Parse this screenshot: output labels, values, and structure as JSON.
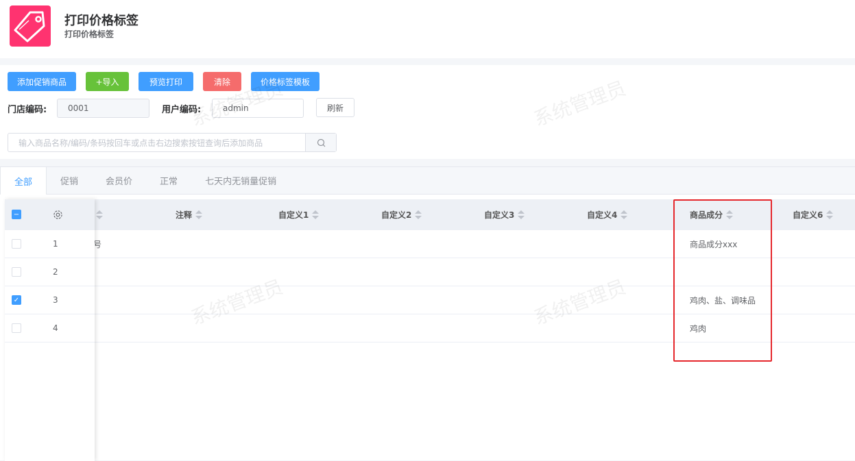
{
  "header": {
    "title": "打印价格标签",
    "subtitle": "打印价格标签",
    "icon": "price-tag-icon"
  },
  "toolbar": {
    "add": "添加促销商品",
    "import": "+导入",
    "preview": "预览打印",
    "clear": "清除",
    "template": "价格标签模板",
    "refresh": "刷新"
  },
  "colors": {
    "blue": "#409eff",
    "green": "#67c23a",
    "red": "#f56c6c",
    "logo": "#ff3370"
  },
  "form": {
    "store_label": "门店编码:",
    "store_value": "0001",
    "user_label": "用户编码:",
    "user_value": "admin"
  },
  "search": {
    "placeholder": "输入商品名称/编码/条码按回车或点击右边搜索按钮查询后添加商品"
  },
  "tabs": [
    "全部",
    "促销",
    "会员价",
    "正常",
    "七天内无销量促销"
  ],
  "table": {
    "columns": [
      "注释",
      "自定义1",
      "自定义2",
      "自定义3",
      "自定义4",
      "商品成分",
      "自定义6"
    ],
    "rows": [
      {
        "no": "1",
        "checked": false,
        "partial": "号",
        "ingredients": "商品成分xxx"
      },
      {
        "no": "2",
        "checked": false,
        "partial": "",
        "ingredients": ""
      },
      {
        "no": "3",
        "checked": true,
        "partial": "",
        "ingredients": "鸡肉、盐、调味品"
      },
      {
        "no": "4",
        "checked": false,
        "partial": "",
        "ingredients": "鸡肉"
      }
    ]
  },
  "watermark": "系统管理员"
}
